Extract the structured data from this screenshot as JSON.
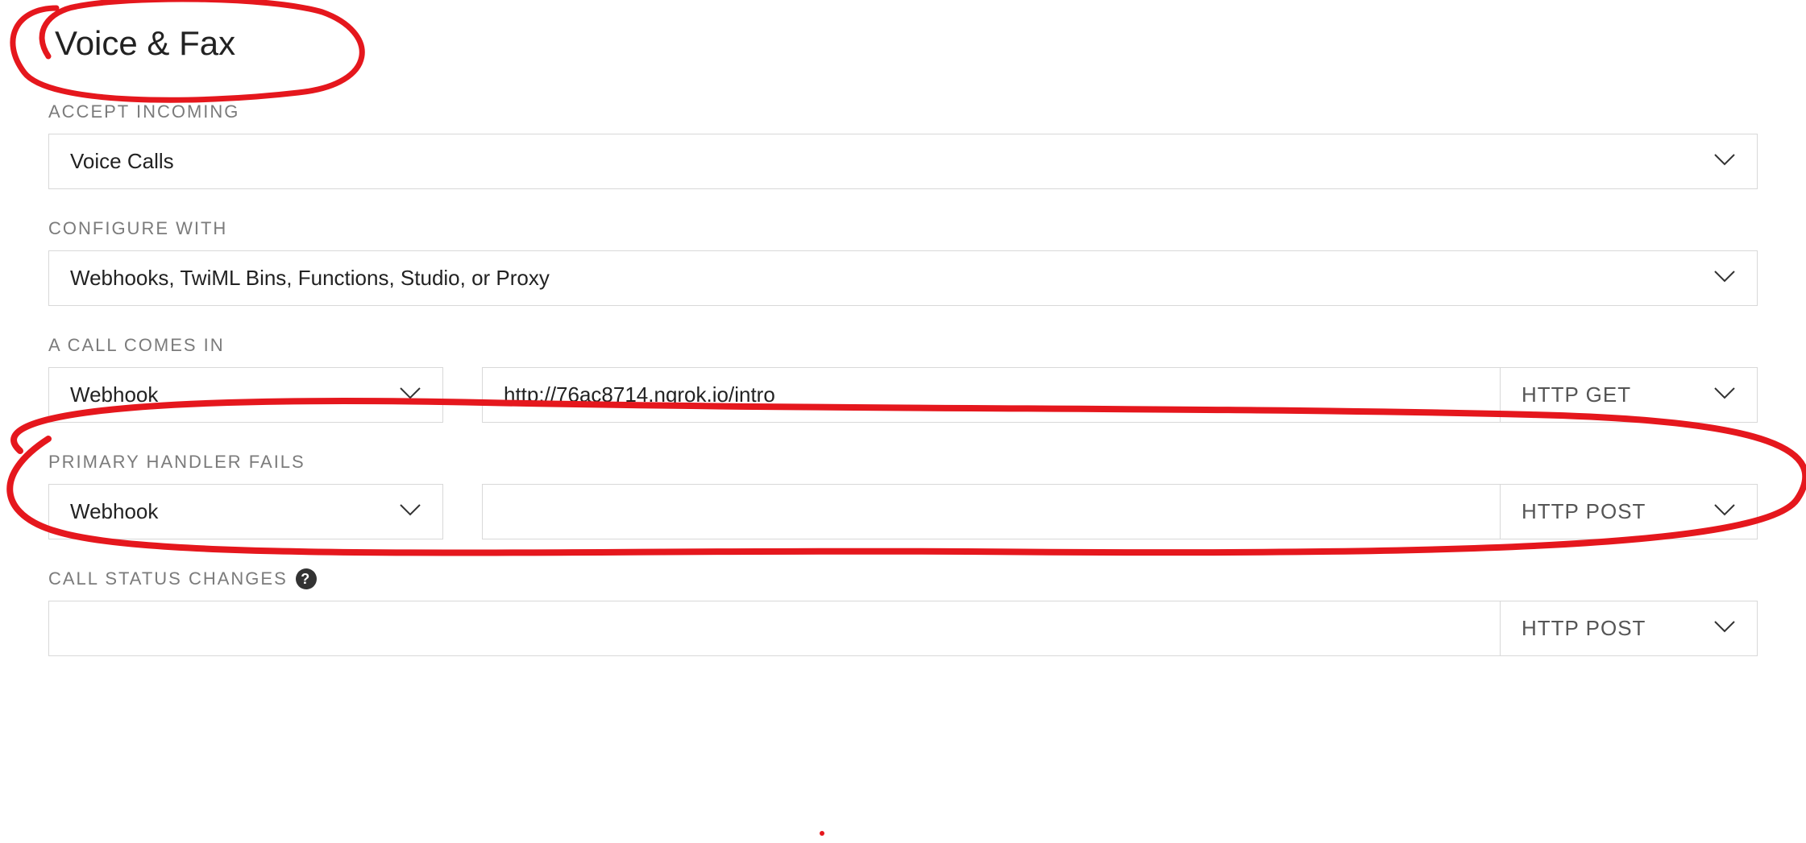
{
  "section": {
    "title": "Voice & Fax"
  },
  "accept_incoming": {
    "label": "ACCEPT INCOMING",
    "value": "Voice Calls"
  },
  "configure_with": {
    "label": "CONFIGURE WITH",
    "value": "Webhooks, TwiML Bins, Functions, Studio, or Proxy"
  },
  "call_comes_in": {
    "label": "A CALL COMES IN",
    "handler": "Webhook",
    "url": "http://76ac8714.ngrok.io/intro",
    "method": "HTTP GET"
  },
  "primary_handler_fails": {
    "label": "PRIMARY HANDLER FAILS",
    "handler": "Webhook",
    "url": "",
    "method": "HTTP POST"
  },
  "call_status_changes": {
    "label": "CALL STATUS CHANGES",
    "url": "",
    "method": "HTTP POST"
  }
}
